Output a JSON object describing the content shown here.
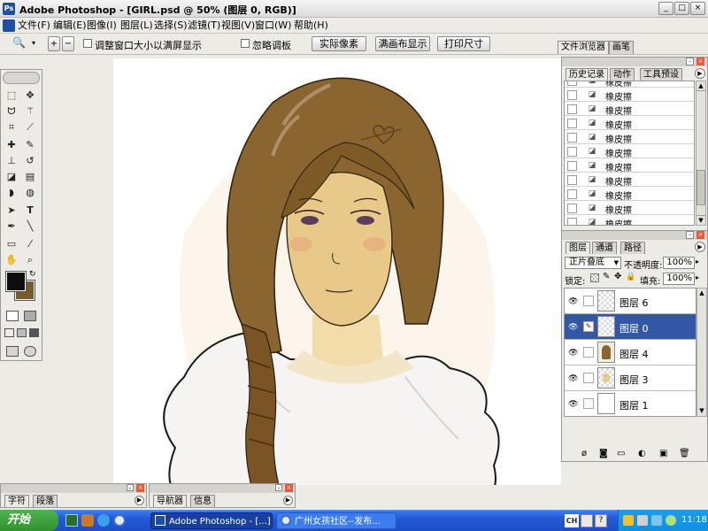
{
  "window": {
    "title": "Adobe Photoshop - [GIRL.psd @ 50% (图层 0, RGB)]",
    "min": "_",
    "max": "□",
    "close": "×"
  },
  "menu": [
    "文件(F)",
    "编辑(E)",
    "图像(I)",
    "图层(L)",
    "选择(S)",
    "滤镜(T)",
    "视图(V)",
    "窗口(W)",
    "帮助(H)"
  ],
  "options": {
    "zoom_icon": "🔍",
    "resize_window_label": "调整窗口大小以满屏显示",
    "ignore_palettes_label": "忽略调板",
    "actual_pixels": "实际像素",
    "fit_on_screen": "满画布显示",
    "print_size": "打印尺寸"
  },
  "palette_well": {
    "tabs": [
      "文件浏览器",
      "画笔"
    ]
  },
  "history_panel": {
    "tabs": [
      "历史记录",
      "动作",
      "工具预设"
    ],
    "items": [
      "橡皮擦",
      "橡皮擦",
      "橡皮擦",
      "橡皮擦",
      "橡皮擦",
      "橡皮擦",
      "橡皮擦",
      "橡皮擦",
      "橡皮擦",
      "橡皮擦",
      "橡皮擦"
    ]
  },
  "layers_panel": {
    "tabs": [
      "图层",
      "通道",
      "路径"
    ],
    "blend_mode": "正片叠底",
    "opacity_label": "不透明度:",
    "opacity_value": "100%",
    "lock_label": "锁定:",
    "fill_label": "填充:",
    "fill_value": "100%",
    "layers": [
      {
        "name": "图层 6",
        "selected": false
      },
      {
        "name": "图层 0",
        "selected": true
      },
      {
        "name": "图层 4",
        "selected": false
      },
      {
        "name": "图层 3",
        "selected": false
      },
      {
        "name": "图层 1",
        "selected": false
      }
    ]
  },
  "bottom_panels": {
    "left_tabs": [
      "字符",
      "段落"
    ],
    "right_tabs": [
      "导航器",
      "信息"
    ]
  },
  "taskbar": {
    "start": "开始",
    "tasks": [
      "Adobe Photoshop - [...]",
      "广州女孩社区--发布..."
    ],
    "lang": "CH",
    "clock": "11:18"
  },
  "colors": {
    "foreground": "#0d0d0d",
    "background": "#7a5a2a",
    "accent": "#3157a5"
  }
}
